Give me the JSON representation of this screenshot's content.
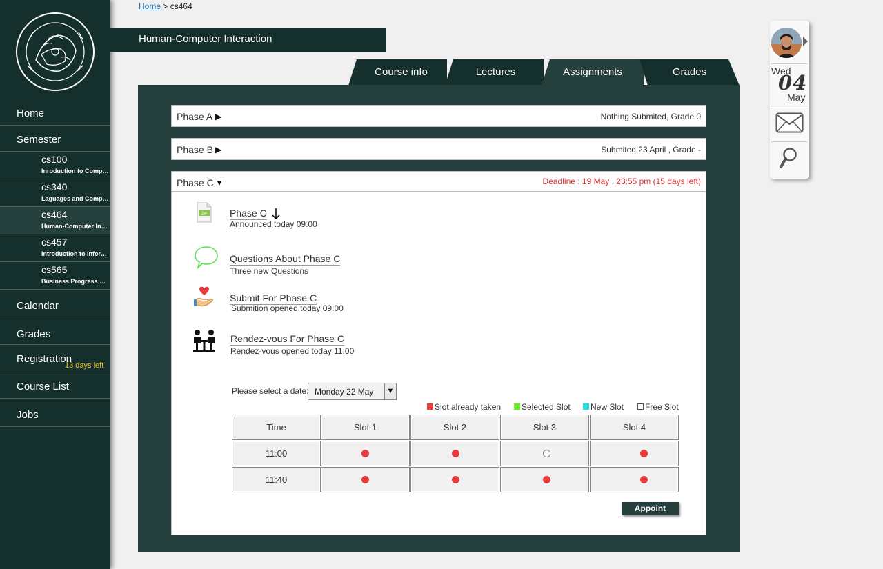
{
  "sidebar": {
    "nav": {
      "home": "Home",
      "semester": "Semester",
      "calendar": "Calendar",
      "grades": "Grades",
      "registration": "Registration",
      "registration_note": "13 days left",
      "course_list": "Course List",
      "jobs": "Jobs"
    },
    "courses": [
      {
        "code": "cs100",
        "name": "Inroduction to Computer Science"
      },
      {
        "code": "cs340",
        "name": "Laguages and Compilers"
      },
      {
        "code": "cs464",
        "name": "Human-Computer Interaction"
      },
      {
        "code": "cs457",
        "name": "Introduction to Information Systems"
      },
      {
        "code": "cs565",
        "name": "Business Progress Management"
      }
    ]
  },
  "breadcrumb": {
    "home": "Home",
    "separator": ">",
    "current": "cs464"
  },
  "course_title": "Human-Computer Interaction",
  "tabs": [
    "Course info",
    "Lectures",
    "Assignments",
    "Grades"
  ],
  "active_tab": "Assignments",
  "phases": [
    {
      "label": "Phase A",
      "status": "Nothing Submited, Grade 0",
      "arrow": "▶"
    },
    {
      "label": "Phase B",
      "status": "Submited 23 April , Grade -",
      "arrow": "▶"
    },
    {
      "label": "Phase C",
      "status": "Deadline : 19 May , 23:55 pm  (15 days left)",
      "arrow": "▼"
    }
  ],
  "phase_c_items": [
    {
      "title": "Phase C",
      "sub": "Announced today 09:00",
      "icon": "zip-file-icon"
    },
    {
      "title": "Questions About Phase C",
      "sub": "Three new Questions",
      "icon": "speech-bubble-icon"
    },
    {
      "title": "Submit For Phase C",
      "sub": "Submition opened today 09:00",
      "icon": "hand-heart-icon"
    },
    {
      "title": "Rendez-vous For Phase C",
      "sub": "Rendez-vous opened today 11:00",
      "icon": "meeting-icon"
    }
  ],
  "date_picker": {
    "label": "Please select a date:",
    "value": "Monday 22 May"
  },
  "legend": [
    {
      "label": "Slot already taken",
      "color": "#e63b3b"
    },
    {
      "label": "Selected Slot",
      "color": "#66ee22"
    },
    {
      "label": "New Slot",
      "color": "#22dde0"
    },
    {
      "label": "Free Slot",
      "color": "#ffffff"
    }
  ],
  "slot_table": {
    "headers": [
      "Time",
      "Slot 1",
      "Slot 2",
      "Slot 3",
      "Slot 4"
    ],
    "rows": [
      {
        "time": "11:00",
        "slots": [
          "taken",
          "taken",
          "free",
          "taken"
        ]
      },
      {
        "time": "11:40",
        "slots": [
          "taken",
          "taken",
          "taken",
          "taken"
        ]
      }
    ]
  },
  "appoint_button": "Appoint",
  "widget": {
    "day_name": "Wed",
    "day_num": "04",
    "month": "May"
  },
  "colors": {
    "sidebar": "#152f2c",
    "panel": "#243f3c",
    "taken": "#e63b3b",
    "deadline": "#e23030"
  }
}
